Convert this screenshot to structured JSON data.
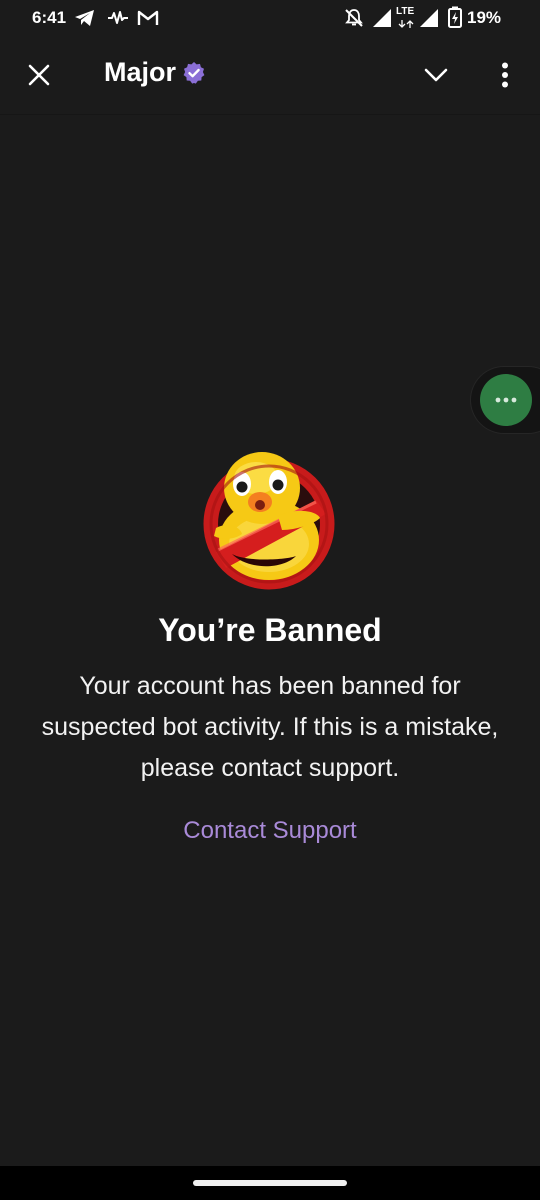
{
  "status_bar": {
    "time": "6:41",
    "network": "LTE",
    "battery": "19%",
    "icons": [
      "telegram-icon",
      "audio-wave-icon",
      "gmail-icon",
      "notifications-off-icon",
      "signal-icon",
      "lte-signal-icon",
      "battery-charging-icon"
    ]
  },
  "header": {
    "title": "Major",
    "verified": true,
    "close_icon": "close-icon",
    "collapse_icon": "chevron-down-icon",
    "menu_icon": "more-vertical-icon"
  },
  "floating_bubble": {
    "icon": "more-horizontal-icon",
    "color": "#2e7d43"
  },
  "content": {
    "title": "You’re Banned",
    "message": "Your account has been banned for suspected bot activity. If this is a mistake, please contact support.",
    "contact_link": "Contact Support",
    "link_color": "#a98ad8",
    "illustration": "banned-duck-illustration"
  },
  "colors": {
    "background": "#1b1b1b",
    "accent": "#a98ad8",
    "verified_badge": "#8b6fd6"
  }
}
